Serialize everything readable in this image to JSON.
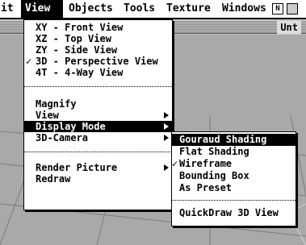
{
  "menubar": {
    "items": [
      "it",
      "View",
      "Objects",
      "Tools",
      "Texture",
      "Windows"
    ],
    "app_icon_glyph": "N"
  },
  "window": {
    "title_fragment": "Unt"
  },
  "view_menu": {
    "items": [
      {
        "label": "XY - Front View",
        "checked": false
      },
      {
        "label": "XZ - Top View",
        "checked": false
      },
      {
        "label": "ZY - Side View",
        "checked": false
      },
      {
        "label": "3D - Perspective View",
        "checked": true
      },
      {
        "label": "4T - 4-Way View",
        "checked": false
      },
      {
        "label": "Magnify",
        "checked": false
      },
      {
        "label": "View",
        "checked": false,
        "submenu": true
      },
      {
        "label": "Display Mode",
        "checked": false,
        "submenu": true,
        "highlighted": true
      },
      {
        "label": "3D-Camera",
        "checked": false,
        "submenu": true
      },
      {
        "label": "Render Picture",
        "checked": false,
        "submenu": true
      },
      {
        "label": "Redraw",
        "checked": false
      }
    ],
    "check_glyph": "✓"
  },
  "display_mode_submenu": {
    "items": [
      {
        "label": "Gouraud Shading",
        "highlighted": true,
        "checked": false
      },
      {
        "label": "Flat Shading",
        "highlighted": false,
        "checked": false
      },
      {
        "label": "Wireframe",
        "highlighted": false,
        "checked": true
      },
      {
        "label": "Bounding Box",
        "highlighted": false,
        "checked": false
      },
      {
        "label": "As Preset",
        "highlighted": false,
        "checked": false
      },
      {
        "label": "QuickDraw 3D View",
        "highlighted": false,
        "checked": false
      }
    ]
  },
  "colors": {
    "highlight_bg": "#000000",
    "highlight_fg": "#ffffff",
    "menu_bg": "#ffffff"
  }
}
